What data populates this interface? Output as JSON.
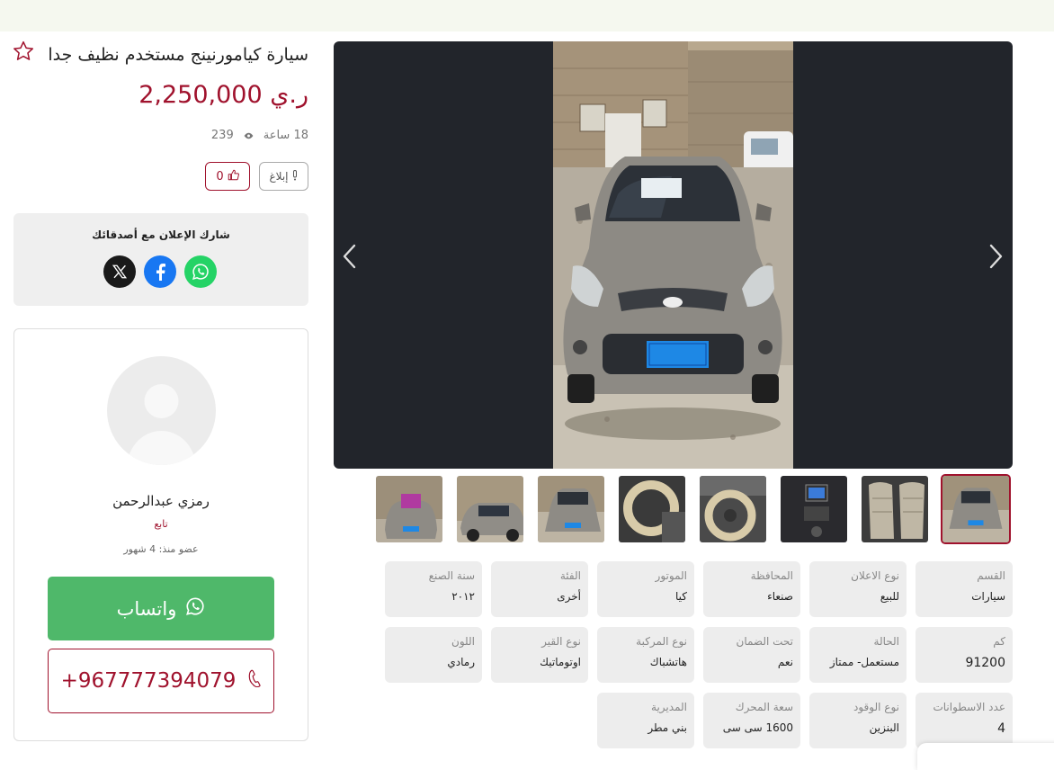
{
  "listing": {
    "title": "سيارة كيامورنينج مستخدم نظيف جدا",
    "price": "2,250,000 ر.ي",
    "time_ago": "18 ساعة",
    "views": "239",
    "likes": "0",
    "report_label": "إبلاغ"
  },
  "share": {
    "title": "شارك الإعلان مع أصدقائك",
    "icons": [
      "x-icon",
      "facebook-icon",
      "whatsapp-icon"
    ],
    "colors": {
      "x": "#1a1a1a",
      "facebook": "#1877f2",
      "whatsapp": "#25d366"
    }
  },
  "seller": {
    "name": "رمزي عبدالرحمن",
    "follow_label": "تابع",
    "member_since": "عضو منذ: 4 شهور",
    "whatsapp_label": "واتساب",
    "phone": "+967777394079"
  },
  "gallery": {
    "thumbnail_count": 8,
    "active_index": 7
  },
  "specs": [
    {
      "label": "القسم",
      "value": "سيارات"
    },
    {
      "label": "نوع الاعلان",
      "value": "للبيع"
    },
    {
      "label": "المحافظة",
      "value": "صنعاء"
    },
    {
      "label": "الموتور",
      "value": "كيا"
    },
    {
      "label": "الفئة",
      "value": "أخرى"
    },
    {
      "label": "سنة الصنع",
      "value": "٢٠١٢"
    },
    {
      "label": "كم",
      "value": "91200"
    },
    {
      "label": "الحالة",
      "value": "مستعمل- ممتاز"
    },
    {
      "label": "تحت الضمان",
      "value": "نعم"
    },
    {
      "label": "نوع المركبة",
      "value": "هاتشباك"
    },
    {
      "label": "نوع القير",
      "value": "اوتوماتيك"
    },
    {
      "label": "اللون",
      "value": "رمادي"
    },
    {
      "label": "عدد الاسطوانات",
      "value": "4"
    },
    {
      "label": "نوع الوقود",
      "value": "البنزين"
    },
    {
      "label": "سعة المحرك",
      "value": "1600 سى سى"
    },
    {
      "label": "المديرية",
      "value": "بني مطر"
    }
  ],
  "colors": {
    "accent": "#a0122d",
    "whatsapp_button": "#4fb86a",
    "gallery_bg": "#22252b"
  }
}
